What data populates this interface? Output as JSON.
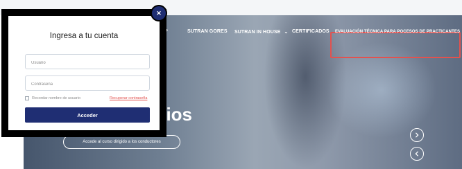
{
  "nav": {
    "items": [
      {
        "label": "UP"
      },
      {
        "label": "SUTRAN GORES"
      },
      {
        "label": "SUTRAN IN HOUSE"
      },
      {
        "label": "CERTIFICADOS"
      },
      {
        "label": "EVALUACIÓN TÉCNICA PARA POCESOS DE PRACTICANTES"
      }
    ],
    "highlight_color": "#e2524f"
  },
  "hero": {
    "title": "ilios",
    "cta_label": "Accede al curso dirigido a los conductores"
  },
  "modal": {
    "close_icon": "close-icon",
    "title": "Ingresa a tu cuenta",
    "username_placeholder": "Usuario",
    "password_placeholder": "Contraseña",
    "remember_label": "Recordar nombre de usuario",
    "recover_label": "Recuperar contraseña",
    "submit_label": "Acceder",
    "accent_color": "#1f2e73"
  },
  "slider": {
    "next_icon": "chevron-right-icon",
    "prev_icon": "chevron-left-icon"
  }
}
